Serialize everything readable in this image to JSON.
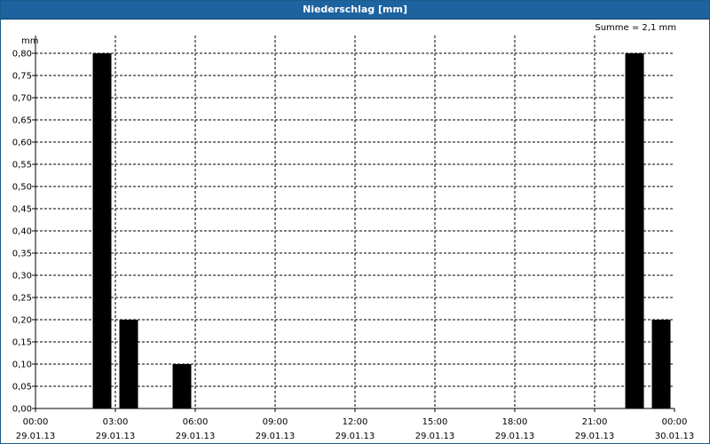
{
  "window": {
    "title": "Niederschlag [mm]"
  },
  "summary": {
    "text": "Summe = 2,1 mm"
  },
  "chart_data": {
    "type": "bar",
    "title": "Niederschlag [mm]",
    "ylabel": "mm",
    "ylim": [
      0,
      0.8
    ],
    "y_ticks": [
      "0,00",
      "0,05",
      "0,10",
      "0,15",
      "0,20",
      "0,25",
      "0,30",
      "0,35",
      "0,40",
      "0,45",
      "0,50",
      "0,55",
      "0,60",
      "0,65",
      "0,70",
      "0,75",
      "0,80"
    ],
    "x_range_hours": [
      0,
      24
    ],
    "x_ticks": [
      {
        "time": "00:00",
        "date": "29.01.13",
        "hour": 0
      },
      {
        "time": "03:00",
        "date": "29.01.13",
        "hour": 3
      },
      {
        "time": "06:00",
        "date": "29.01.13",
        "hour": 6
      },
      {
        "time": "09:00",
        "date": "29.01.13",
        "hour": 9
      },
      {
        "time": "12:00",
        "date": "29.01.13",
        "hour": 12
      },
      {
        "time": "15:00",
        "date": "29.01.13",
        "hour": 15
      },
      {
        "time": "18:00",
        "date": "29.01.13",
        "hour": 18
      },
      {
        "time": "21:00",
        "date": "29.01.13",
        "hour": 21
      },
      {
        "time": "00:00",
        "date": "30.01.13",
        "hour": 24
      }
    ],
    "bars": [
      {
        "hour": 2.5,
        "value": 0.8
      },
      {
        "hour": 3.5,
        "value": 0.2
      },
      {
        "hour": 5.5,
        "value": 0.1
      },
      {
        "hour": 22.5,
        "value": 0.8
      },
      {
        "hour": 23.5,
        "value": 0.2
      }
    ],
    "grid": true,
    "bar_color": "#000000",
    "grid_color": "#000000"
  }
}
